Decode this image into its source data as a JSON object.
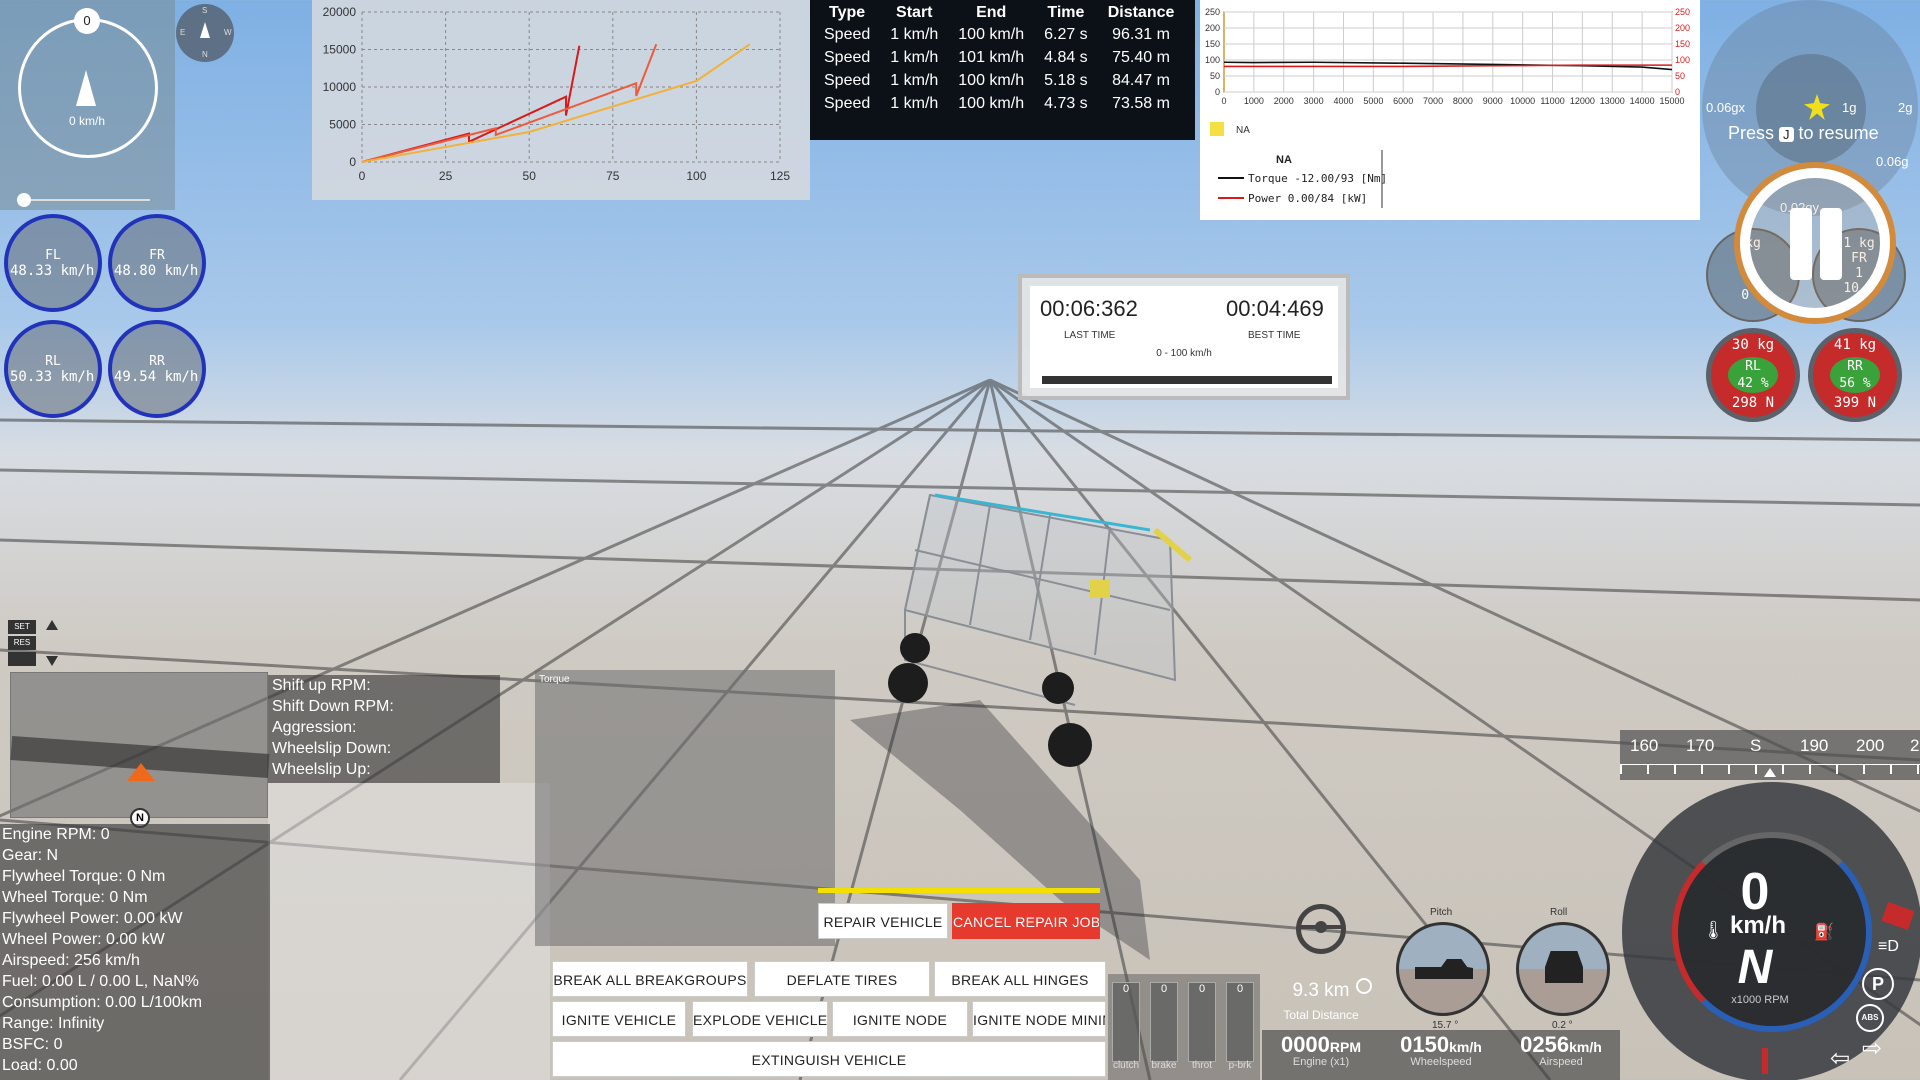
{
  "compass": {
    "top_marker": "0",
    "speed": "0 km/h"
  },
  "mini_compass": {
    "n": "N",
    "s": "S",
    "e": "E",
    "w": "W"
  },
  "tires": [
    {
      "pos": "FL",
      "speed": "48.33 km/h"
    },
    {
      "pos": "FR",
      "speed": "48.80 km/h"
    },
    {
      "pos": "RL",
      "speed": "50.33 km/h"
    },
    {
      "pos": "RR",
      "speed": "49.54 km/h"
    }
  ],
  "chart_data": [
    {
      "type": "line",
      "title": "",
      "xlabel": "",
      "ylabel": "",
      "xlim": [
        0,
        125
      ],
      "ylim": [
        0,
        20000
      ],
      "x_ticks": [
        "0",
        "25",
        "50",
        "75",
        "100",
        "125"
      ],
      "y_ticks": [
        "20000",
        "15000",
        "10000",
        "5000",
        "0"
      ],
      "grid": true,
      "series": [
        {
          "color": "#d81a1a",
          "points": [
            [
              0,
              0
            ],
            [
              32,
              3800
            ],
            [
              32,
              2700
            ],
            [
              61,
              8700
            ],
            [
              61,
              6200
            ],
            [
              65,
              15500
            ]
          ]
        },
        {
          "color": "#ee5a3c",
          "points": [
            [
              0,
              0
            ],
            [
              40,
              4500
            ],
            [
              40,
              3600
            ],
            [
              82,
              10500
            ],
            [
              82,
              8800
            ],
            [
              88,
              15700
            ]
          ]
        },
        {
          "color": "#f2b13a",
          "points": [
            [
              0,
              0
            ],
            [
              50,
              4000
            ],
            [
              100,
              10800
            ],
            [
              116,
              15700
            ]
          ]
        }
      ]
    },
    {
      "type": "line",
      "title": "",
      "xlim": [
        0,
        15000
      ],
      "ylim": [
        0,
        250
      ],
      "x_ticks": [
        "0",
        "1000",
        "2000",
        "3000",
        "4000",
        "5000",
        "6000",
        "7000",
        "8000",
        "9000",
        "10000",
        "11000",
        "12000",
        "13000",
        "14000",
        "15000"
      ],
      "y_ticks_left": [
        "250",
        "200",
        "150",
        "100",
        "50",
        "0"
      ],
      "y_ticks_right": [
        "250",
        "200",
        "150",
        "100",
        "50",
        "0"
      ],
      "grid": true,
      "legend_swatch_label": "NA",
      "legend": {
        "title": "NA",
        "entries": [
          {
            "label": "Torque",
            "value": "-12.00/93",
            "unit": "[Nm]",
            "color": "#111111"
          },
          {
            "label": "Power",
            "value": "0.00/84",
            "unit": "[kW]",
            "color": "#d81a1a"
          }
        ]
      },
      "series": [
        {
          "name": "Torque",
          "color": "#111111",
          "x": [
            0,
            1000,
            3000,
            6000,
            9000,
            12000,
            14000,
            15000
          ],
          "values": [
            93,
            92,
            93,
            90,
            86,
            82,
            78,
            70
          ]
        },
        {
          "name": "Power",
          "color": "#d81a1a",
          "x": [
            0,
            1000,
            3000,
            6000,
            9000,
            12000,
            14000,
            15000
          ],
          "values": [
            80,
            80,
            80,
            80,
            82,
            84,
            84,
            84
          ]
        }
      ]
    }
  ],
  "speed_table": {
    "headers": [
      "Type",
      "Start",
      "End",
      "Time",
      "Distance"
    ],
    "rows": [
      [
        "Speed",
        "1 km/h",
        "100 km/h",
        "6.27 s",
        "96.31 m"
      ],
      [
        "Speed",
        "1 km/h",
        "101 km/h",
        "4.84 s",
        "75.40 m"
      ],
      [
        "Speed",
        "1 km/h",
        "100 km/h",
        "5.18 s",
        "84.47 m"
      ],
      [
        "Speed",
        "1 km/h",
        "100 km/h",
        "4.73 s",
        "73.58 m"
      ]
    ]
  },
  "resume": {
    "press": "Press",
    "key": "J",
    "to_resume": "to resume",
    "g_labels": [
      "0.06gx",
      "1g",
      "2g",
      "0.06g",
      "0.02gy"
    ]
  },
  "tire_load": [
    {
      "top": "kg",
      "pos": "",
      "pct": "0",
      "bottom": "0 N"
    },
    {
      "top": "1 kg",
      "pos": "FR",
      "pct": "1",
      "bottom": "10 N"
    },
    {
      "top": "30 kg",
      "pos": "RL",
      "pct": "42 %",
      "bottom": "298 N"
    },
    {
      "top": "41 kg",
      "pos": "RR",
      "pct": "56 %",
      "bottom": "399 N"
    }
  ],
  "timer": {
    "last_time": "00:06:362",
    "last_label": "LAST TIME",
    "best_time": "00:04:469",
    "best_label": "BEST TIME",
    "range": "0 - 100 km/h"
  },
  "cruise": {
    "set": "SET",
    "res": "RES"
  },
  "shift": {
    "lines": [
      "Shift up RPM:",
      "Shift Down RPM:",
      "Aggression:",
      "Wheelslip Down:",
      "Wheelslip Up:"
    ]
  },
  "torque_graph_title": "Torque",
  "map": {
    "n_marker": "N"
  },
  "info": {
    "lines": [
      "Engine RPM: 0",
      "Gear: N",
      "Flywheel Torque: 0 Nm",
      "Wheel Torque: 0 Nm",
      "Flywheel Power: 0.00 kW",
      "Wheel Power: 0.00 kW",
      "Airspeed: 256 km/h",
      "Fuel: 0.00 L / 0.00 L, NaN%",
      "Consumption: 0.00 L/100km",
      "Range: Infinity",
      "BSFC: 0",
      "Load: 0.00"
    ]
  },
  "buttons": {
    "repair": "REPAIR VEHICLE",
    "cancel_repair": "CANCEL REPAIR JOB",
    "break_breakgroups": "BREAK ALL BREAKGROUPS",
    "deflate_tires": "DEFLATE TIRES",
    "break_hinges": "BREAK ALL HINGES",
    "ignite_vehicle": "IGNITE VEHICLE",
    "explode_vehicle": "EXPLODE VEHICLE",
    "ignite_node": "IGNITE NODE",
    "ignite_node_min": "IGNITE NODE MINIM",
    "extinguish": "EXTINGUISH VEHICLE"
  },
  "pedals": [
    {
      "value": "0",
      "label": "clutch"
    },
    {
      "value": "0",
      "label": "brake"
    },
    {
      "value": "0",
      "label": "throt"
    },
    {
      "value": "0",
      "label": "p-brk"
    }
  ],
  "distance": {
    "value": "9.3 km",
    "label": "Total Distance"
  },
  "strip": [
    {
      "value": "0000",
      "unit": "RPM",
      "label": "Engine (x1)"
    },
    {
      "value": "0150",
      "unit": "km/h",
      "label": "Wheelspeed"
    },
    {
      "value": "0256",
      "unit": "km/h",
      "label": "Airspeed"
    }
  ],
  "attitude": {
    "pitch_label": "Pitch",
    "pitch_value": "15.7 °",
    "roll_label": "Roll",
    "roll_value": "0.2 °"
  },
  "heading": {
    "ticks": [
      "160",
      "170",
      "S",
      "190",
      "200",
      "2"
    ]
  },
  "speedo": {
    "gear": "0",
    "unit": "km/h",
    "gear_letter": "N",
    "rpm_label": "x1000 RPM",
    "abs": "ABS",
    "park": "P"
  },
  "colors": {
    "tire_ring": "#2233bb",
    "tire_hot": "#c62b2b",
    "accent_repair": "#e53a2d",
    "repair_bar": "#f4e000",
    "pause_glow": "#d38a3a"
  }
}
